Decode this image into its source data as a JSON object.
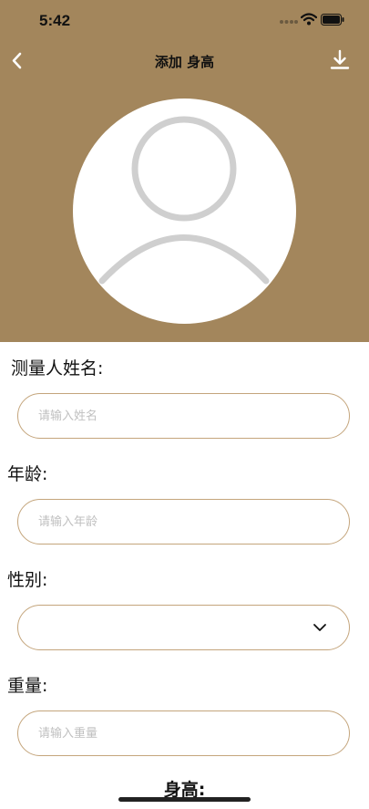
{
  "status": {
    "time": "5:42"
  },
  "nav": {
    "title": "添加 身高"
  },
  "form": {
    "name": {
      "label": "测量人姓名:",
      "placeholder": "请输入姓名"
    },
    "age": {
      "label": "年龄:",
      "placeholder": "请输入年龄"
    },
    "gender": {
      "label": "性别:",
      "value": ""
    },
    "weight": {
      "label": "重量:",
      "placeholder": "请输入重量"
    },
    "height": {
      "label": "身高:"
    }
  },
  "colors": {
    "header_bg": "#a3865c",
    "field_border": "#c4a57c"
  },
  "icons": [
    "back-chevron-icon",
    "download-icon",
    "avatar-placeholder-icon",
    "chevron-down-icon",
    "signal-icon",
    "wifi-icon",
    "battery-icon"
  ]
}
